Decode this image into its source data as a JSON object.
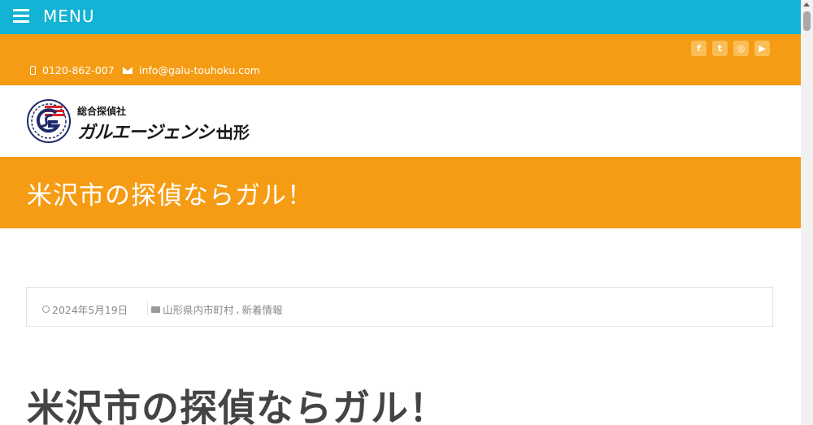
{
  "menu": {
    "label": "MENU"
  },
  "contact": {
    "phone": "0120-862-007",
    "email": "info@galu-touhoku.com"
  },
  "social": {
    "facebook": "f",
    "twitter": "t",
    "instagram": "◎",
    "youtube": "▶"
  },
  "logo": {
    "small_text": "総合探偵社",
    "main_text": "ガルエージェンシー",
    "place": "山形"
  },
  "banner": {
    "title": "米沢市の探偵ならガル！"
  },
  "meta": {
    "date": "2024年5月19日",
    "categories": [
      "山形県内市町村",
      "新着情報"
    ],
    "separator": ","
  },
  "article": {
    "title": "米沢市の探偵ならガル！"
  },
  "colors": {
    "menu_bg": "#12b3d4",
    "accent_orange": "#f59c14",
    "text_dark": "#444444"
  }
}
